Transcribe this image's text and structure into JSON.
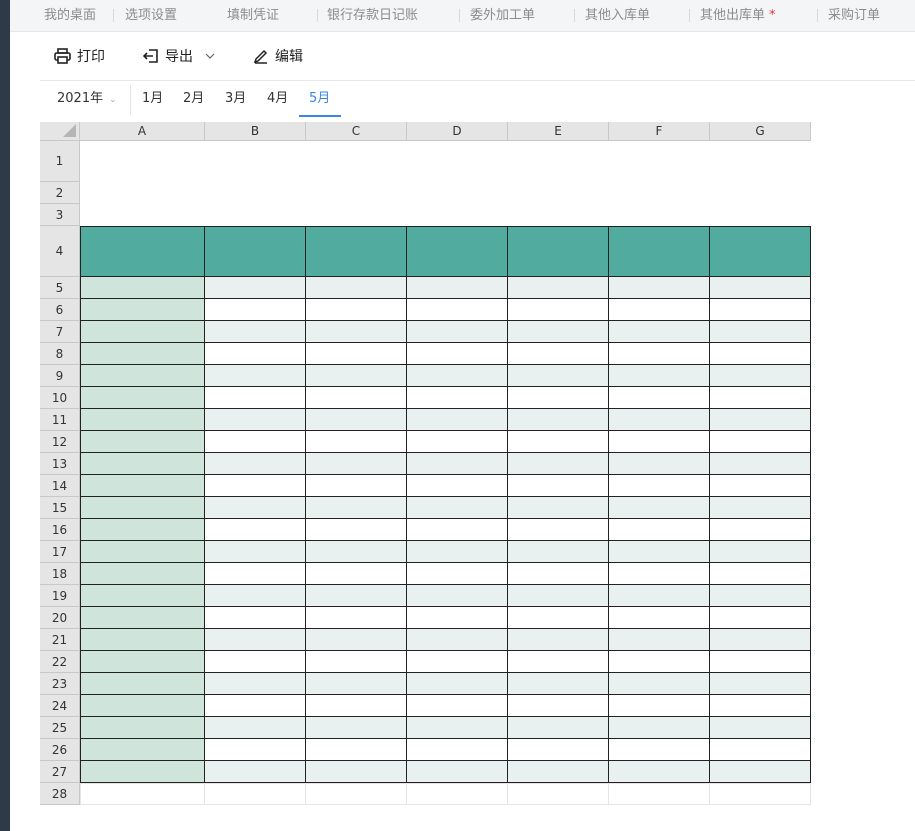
{
  "tabs": [
    {
      "label": "我的桌面",
      "modified": false
    },
    {
      "label": "选项设置",
      "modified": false
    },
    {
      "label": "填制凭证",
      "modified": false
    },
    {
      "label": "银行存款日记账",
      "modified": false
    },
    {
      "label": "委外加工单",
      "modified": false
    },
    {
      "label": "其他入库单",
      "modified": false
    },
    {
      "label": "其他出库单",
      "modified": true,
      "marker": "*"
    },
    {
      "label": "采购订单",
      "modified": false
    }
  ],
  "toolbar": {
    "print_label": "打印",
    "export_label": "导出",
    "edit_label": "编辑",
    "icons": [
      "printer-icon",
      "export-icon",
      "chevron-down-icon",
      "pencil-icon"
    ]
  },
  "period": {
    "year": "2021年",
    "months": [
      "1月",
      "2月",
      "3月",
      "4月",
      "5月"
    ],
    "active_month": "5月"
  },
  "sheet": {
    "columns": [
      "A",
      "B",
      "C",
      "D",
      "E",
      "F",
      "G"
    ],
    "rows": [
      "1",
      "2",
      "3",
      "4",
      "5",
      "6",
      "7",
      "8",
      "9",
      "10",
      "11",
      "12",
      "13",
      "14",
      "15",
      "16",
      "17",
      "18",
      "19",
      "20",
      "21",
      "22",
      "23",
      "24",
      "25",
      "26",
      "27",
      "28"
    ],
    "header_row": "4",
    "colors": {
      "header_fill": "#52ab9f",
      "label_column_fill": "#cfe4db",
      "band_fill": "#e8f1ef",
      "plain_fill": "#ffffff",
      "border": "#222222"
    }
  }
}
